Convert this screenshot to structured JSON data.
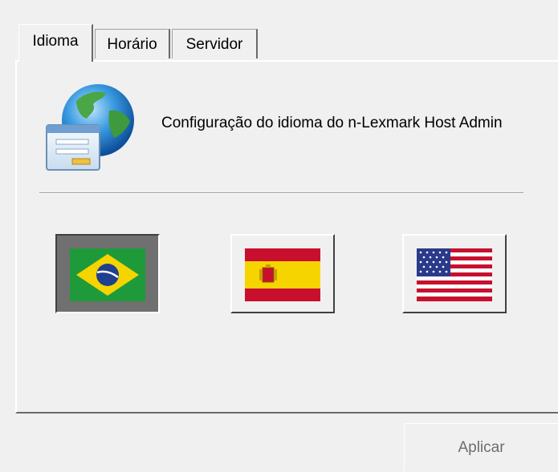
{
  "tabs": [
    {
      "label": "Idioma",
      "active": true
    },
    {
      "label": "Horário",
      "active": false
    },
    {
      "label": "Servidor",
      "active": false
    }
  ],
  "language_page": {
    "description": "Configuração do idioma do n-Lexmark Host Admin",
    "header_icon": "globe-window-icon",
    "languages": [
      {
        "flag": "brazil-flag-icon",
        "selected": true
      },
      {
        "flag": "spain-flag-icon",
        "selected": false
      },
      {
        "flag": "usa-flag-icon",
        "selected": false
      }
    ]
  },
  "actions": {
    "apply_label": "Aplicar",
    "apply_enabled": false
  }
}
